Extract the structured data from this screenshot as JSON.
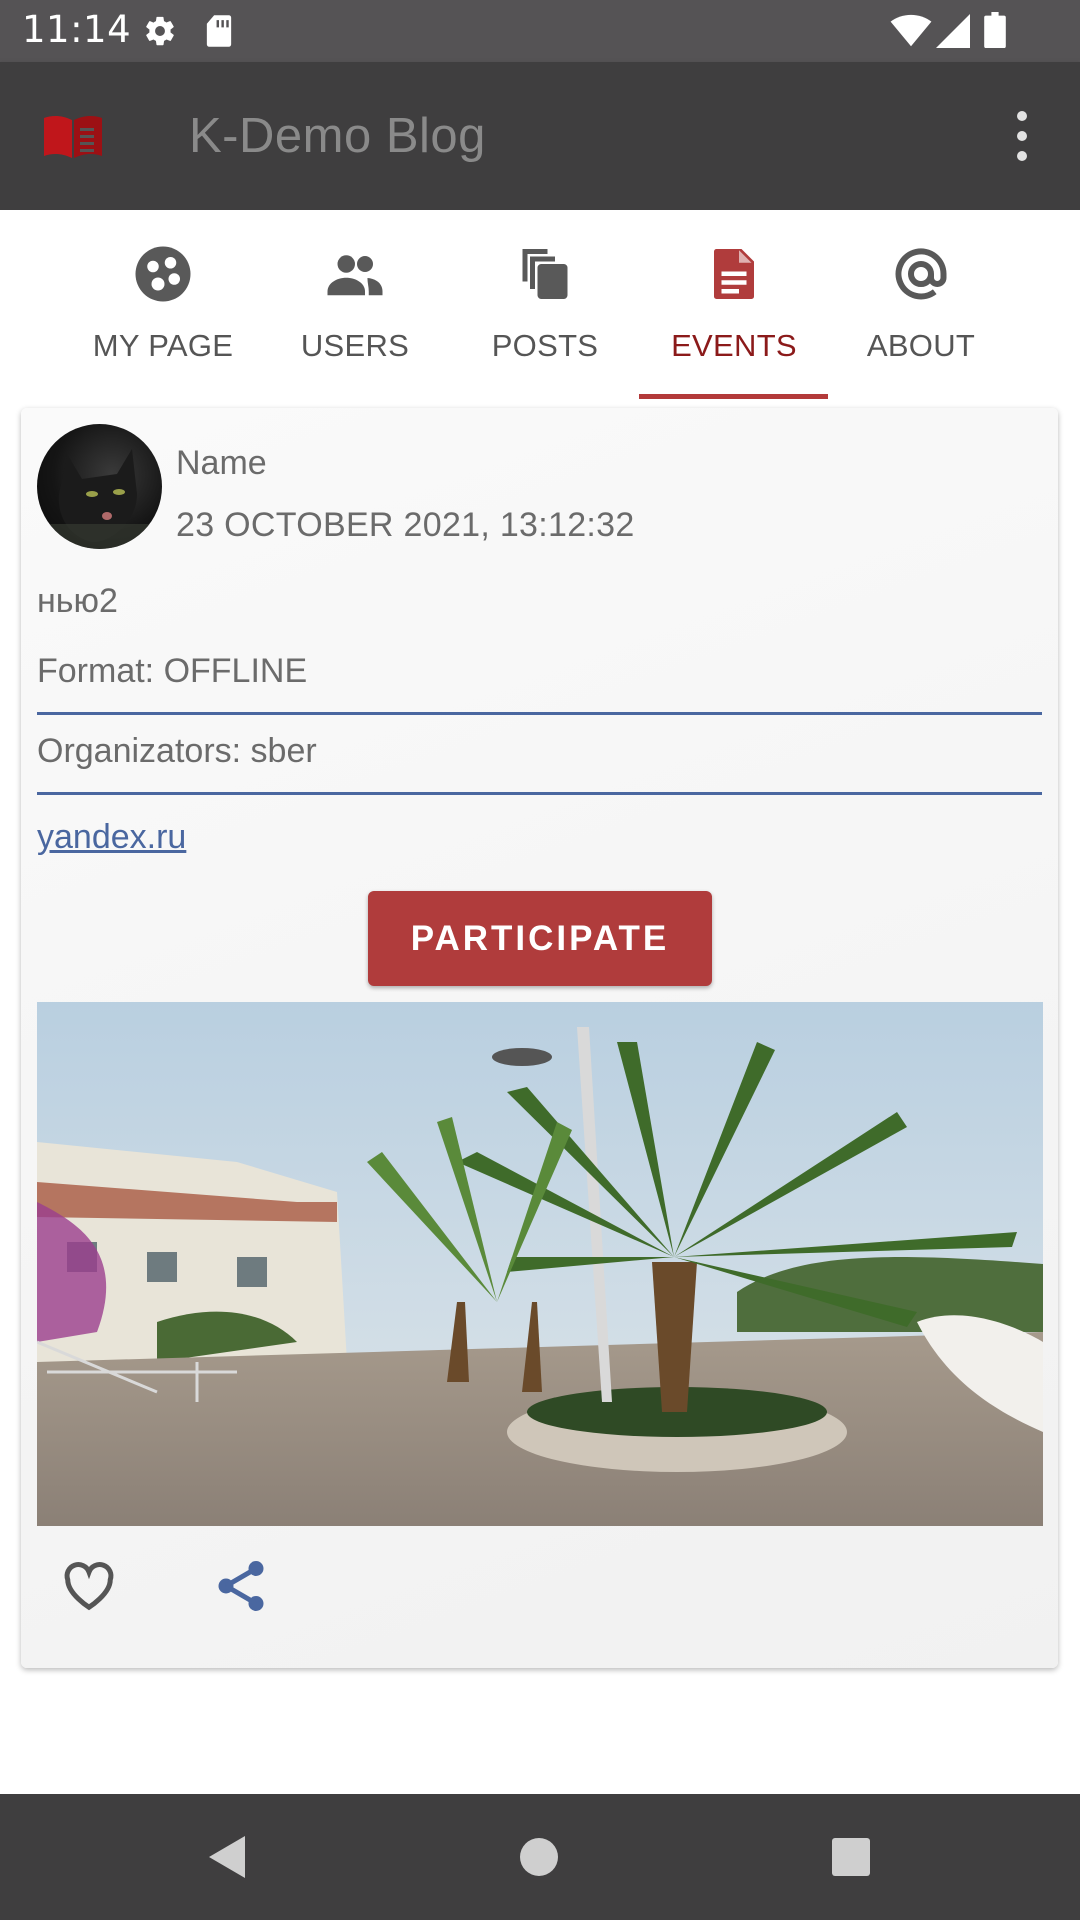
{
  "status_bar": {
    "time": "11:14",
    "icons": [
      "gear-icon",
      "sd-card-icon",
      "wifi-icon",
      "signal-icon",
      "battery-icon"
    ]
  },
  "app_bar": {
    "title": "K-Demo Blog",
    "logo_icon": "book-icon",
    "menu_icon": "more-vert-icon"
  },
  "tabs": [
    {
      "label": "MY PAGE",
      "icon": "face-icon",
      "active": false
    },
    {
      "label": "USERS",
      "icon": "people-icon",
      "active": false
    },
    {
      "label": "POSTS",
      "icon": "copy-icon",
      "active": false
    },
    {
      "label": "EVENTS",
      "icon": "article-icon",
      "active": true
    },
    {
      "label": "ABOUT",
      "icon": "at-icon",
      "active": false
    }
  ],
  "event": {
    "author": "Name",
    "published": "23 OCTOBER 2021, 13:12:32",
    "content": "нью2",
    "format": "Format: OFFLINE",
    "organizators": "Organizators: sber",
    "link": "yandex.ru",
    "participate_label": "PARTICIPATE"
  },
  "colors": {
    "app_bar": "#3f3e3f",
    "accent": "#b03c3c",
    "active_tab_text": "#8b1a1a",
    "link": "#4a67a0"
  },
  "nav_bar": {
    "icons": [
      "back-icon",
      "home-icon",
      "recents-icon"
    ]
  }
}
